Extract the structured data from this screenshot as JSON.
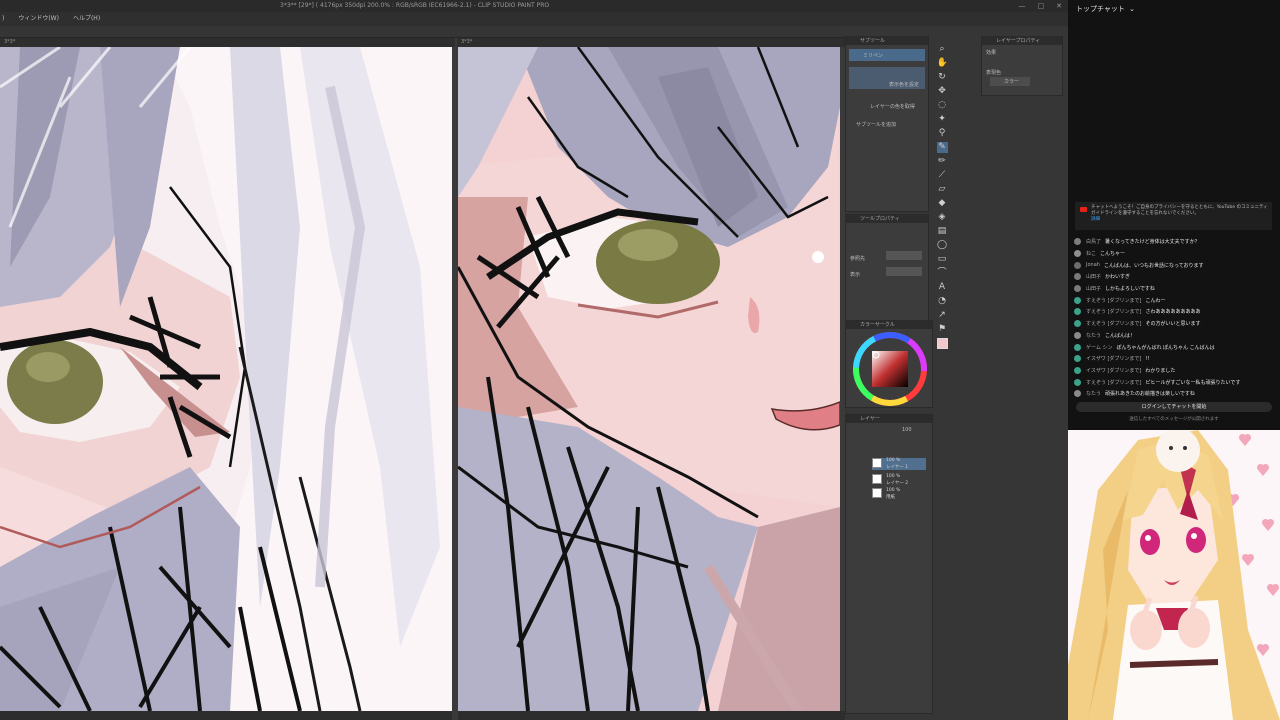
{
  "window": {
    "title": "3*3** [29*] ( 4176px 350dpi 200.0% : RGB/sRGB IEC61966-2.1) - CLIP STUDIO PAINT PRO",
    "controls": [
      "—",
      "□",
      "✕"
    ]
  },
  "menu": {
    "items": [
      ")",
      "ウィンドウ(W)",
      "ヘルプ(H)"
    ]
  },
  "tabs": {
    "left": "3*3*",
    "right": "3*3*"
  },
  "panels": {
    "subtool_header": "サブツール",
    "subtool_items": [
      "ミリペン",
      "",
      "カーソル"
    ],
    "subtool_labels": [
      "表示色を設定",
      "レイヤーの色を取得",
      "サブツールを追加"
    ],
    "tooloption_header": "ツールプロパティ",
    "tooloption_row1": "参照先",
    "tooloption_row2": "表示",
    "color_header": "カラーサークル",
    "layer_header": "レイヤー",
    "layers": [
      {
        "pct": "100 %",
        "mode": "通常",
        "name": "レイヤー 1"
      },
      {
        "pct": "100 %",
        "mode": "通常",
        "name": "レイヤー 2"
      },
      {
        "pct": "100 %",
        "mode": "通常",
        "name": "用紙"
      }
    ],
    "layer_zoom": "100",
    "property_header": "レイヤープロパティ",
    "property_row1": "効果",
    "property_row2": "表現色",
    "property_row3": "カラー"
  },
  "chat": {
    "header": "トップチャット",
    "header_icon": "chevron-down-icon",
    "welcome": "チャットへようこそ！ご自身のプライバシーを守るとともに、YouTube のコミュニティ ガイドラインを遵守することを忘れないでください。",
    "welcome_link": "詳細",
    "messages": [
      {
        "author": "白鳥了",
        "text": "暑くなってきたけど身体は大丈夫ですか？",
        "color": "#7d7d7d"
      },
      {
        "author": "ねこ",
        "text": "こんちゃー",
        "color": "#8f8f8f"
      },
      {
        "author": "Jonah",
        "text": "こんばんは、いつもお世話になっております",
        "color": "#6d6d6d"
      },
      {
        "author": "山田子",
        "text": "かわいすぎ",
        "color": "#7a7a7a"
      },
      {
        "author": "山田子",
        "text": "しかもよろしいですね",
        "color": "#7a7a7a"
      },
      {
        "author": "すえぞう [ダブリンまで]",
        "text": "こんわー",
        "color": "#3aa38a"
      },
      {
        "author": "すえぞう [ダブリンまで]",
        "text": "さわあああああああああ",
        "color": "#3aa38a"
      },
      {
        "author": "すえぞう [ダブリンまで]",
        "text": "その方がいいと思います",
        "color": "#3aa38a"
      },
      {
        "author": "なたう",
        "text": "こんばんは！",
        "color": "#8a8a8a"
      },
      {
        "author": "ゲーム シン",
        "text": "ぽんちゃんがんばれ ぽんちゃん こんばんは",
        "color": "#3aa38a"
      },
      {
        "author": "イスザワ [ダブリンまで]",
        "text": "!!",
        "color": "#3aa38a"
      },
      {
        "author": "イスザワ [ダブリンまで]",
        "text": "わかりました",
        "color": "#3aa38a"
      },
      {
        "author": "すえぞう [ダブリンまで]",
        "text": "ピヒールがすごいなー私も頑張りたいです",
        "color": "#3aa38a"
      },
      {
        "author": "なたう",
        "text": "頑張れあきたのお絵描きは楽しいですね",
        "color": "#8a8a8a"
      }
    ],
    "login_button": "ログインしてチャットを開始",
    "login_note": "送信したすべてのメッセージが公開されます"
  },
  "colors": {
    "app_bg": "#3a3a3a",
    "chat_bg": "#121212",
    "accent_member": "#3aa38a",
    "hair_shadow": "#a8a6be",
    "skin": "#f3d6d6",
    "eye": "#7c7c4a",
    "outline": "#111111"
  }
}
